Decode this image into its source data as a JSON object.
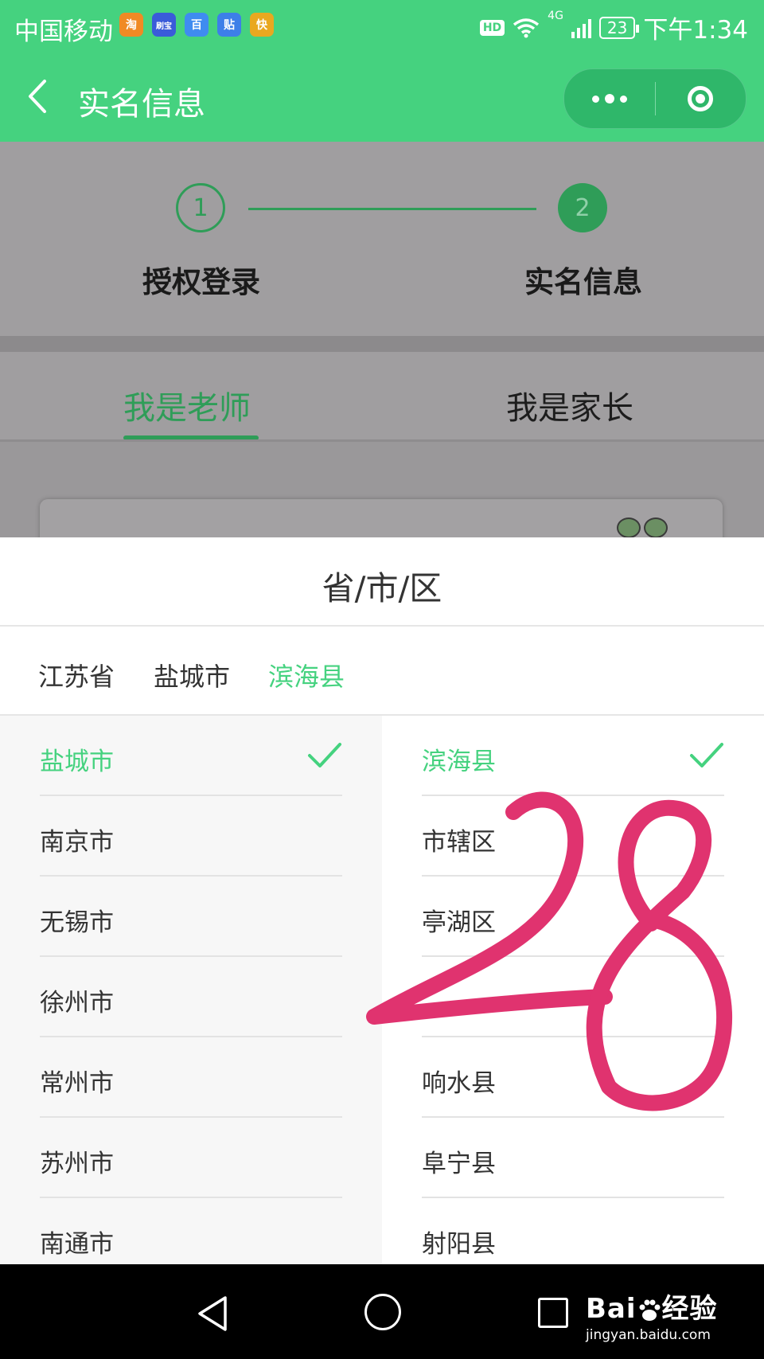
{
  "status_bar": {
    "carrier": "中国移动",
    "app_icons": [
      {
        "name": "taobao-app-icon",
        "glyph": "淘",
        "color": "#f08a24"
      },
      {
        "name": "shuabao-app-icon",
        "glyph": "刷宝",
        "color": "#3a5bd9"
      },
      {
        "name": "baidu-app-icon",
        "glyph": "百",
        "color": "#3f8cf0"
      },
      {
        "name": "tieba-app-icon",
        "glyph": "贴",
        "color": "#3d7fe8"
      },
      {
        "name": "kuaishou-app-icon",
        "glyph": "快",
        "color": "#e9a820"
      }
    ],
    "hd": "HD",
    "network": "4G",
    "battery": "23",
    "time": "下午1:34"
  },
  "navbar": {
    "title": "实名信息"
  },
  "steps": [
    {
      "number": "1",
      "label": "授权登录"
    },
    {
      "number": "2",
      "label": "实名信息"
    }
  ],
  "tabs": [
    {
      "label": "我是老师",
      "active": true
    },
    {
      "label": "我是家长",
      "active": false
    }
  ],
  "picker": {
    "title": "省/市/区",
    "breadcrumb": [
      "江苏省",
      "盐城市",
      "滨海县"
    ],
    "left_column": [
      {
        "label": "盐城市",
        "selected": true
      },
      {
        "label": "南京市",
        "selected": false
      },
      {
        "label": "无锡市",
        "selected": false
      },
      {
        "label": "徐州市",
        "selected": false
      },
      {
        "label": "常州市",
        "selected": false
      },
      {
        "label": "苏州市",
        "selected": false
      },
      {
        "label": "南通市",
        "selected": false
      }
    ],
    "right_column": [
      {
        "label": "滨海县",
        "selected": true
      },
      {
        "label": "市辖区",
        "selected": false
      },
      {
        "label": "亭湖区",
        "selected": false
      },
      {
        "label": "",
        "selected": false
      },
      {
        "label": "响水县",
        "selected": false
      },
      {
        "label": "阜宁县",
        "selected": false
      },
      {
        "label": "射阳县",
        "selected": false
      }
    ],
    "accent_color": "#45d27f"
  },
  "watermark": {
    "brand": "Bai",
    "brand_suffix": "经验",
    "url": "jingyan.baidu.com"
  }
}
